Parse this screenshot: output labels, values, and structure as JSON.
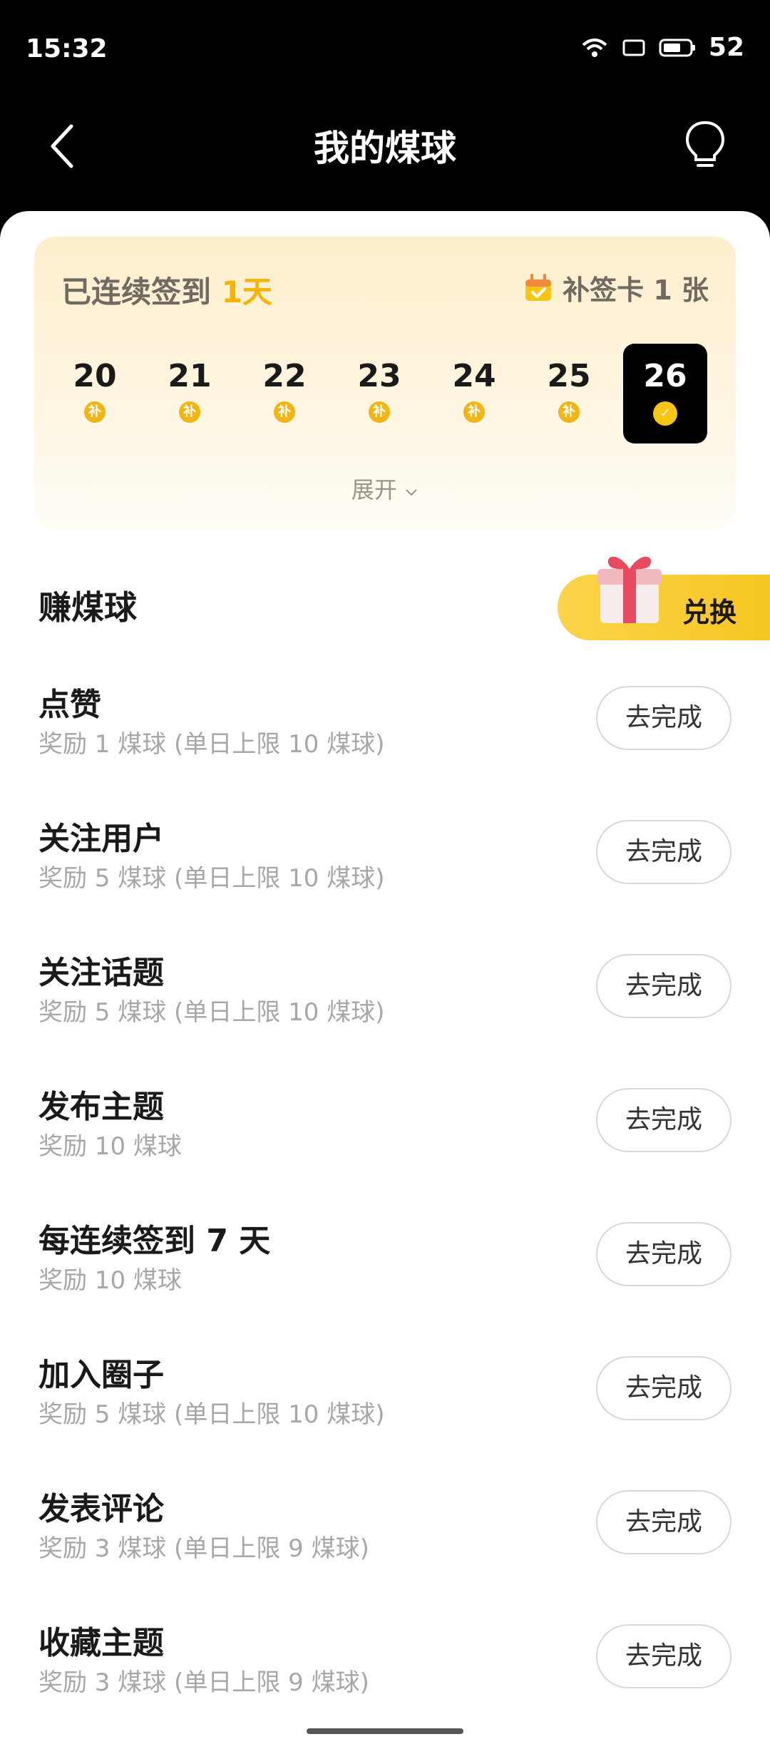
{
  "status_bar": {
    "time": "15:32",
    "battery": "52"
  },
  "nav": {
    "title": "我的煤球"
  },
  "checkin": {
    "streak_prefix": "已连续签到",
    "streak_days": "1天",
    "makeup_card": "补签卡 1 张",
    "days": [
      {
        "num": "20",
        "badge": "补"
      },
      {
        "num": "21",
        "badge": "补"
      },
      {
        "num": "22",
        "badge": "补"
      },
      {
        "num": "23",
        "badge": "补"
      },
      {
        "num": "24",
        "badge": "补"
      },
      {
        "num": "25",
        "badge": "补"
      },
      {
        "num": "26",
        "badge": "✓"
      }
    ],
    "expand_label": "展开"
  },
  "earn": {
    "title": "赚煤球",
    "exchange_label": "兑换"
  },
  "tasks": [
    {
      "title": "点赞",
      "reward": "奖励 1 煤球 (单日上限 10 煤球)",
      "button": "去完成"
    },
    {
      "title": "关注用户",
      "reward": "奖励 5 煤球 (单日上限 10 煤球)",
      "button": "去完成"
    },
    {
      "title": "关注话题",
      "reward": "奖励 5 煤球 (单日上限 10 煤球)",
      "button": "去完成"
    },
    {
      "title": "发布主题",
      "reward": "奖励 10 煤球",
      "button": "去完成"
    },
    {
      "title": "每连续签到 7 天",
      "reward": "奖励 10 煤球",
      "button": "去完成"
    },
    {
      "title": "加入圈子",
      "reward": "奖励 5 煤球 (单日上限 10 煤球)",
      "button": "去完成"
    },
    {
      "title": "发表评论",
      "reward": "奖励 3 煤球 (单日上限 9 煤球)",
      "button": "去完成"
    },
    {
      "title": "收藏主题",
      "reward": "奖励 3 煤球 (单日上限 9 煤球)",
      "button": "去完成"
    }
  ],
  "colors": {
    "accent": "#f5b400",
    "background": "#000000"
  }
}
